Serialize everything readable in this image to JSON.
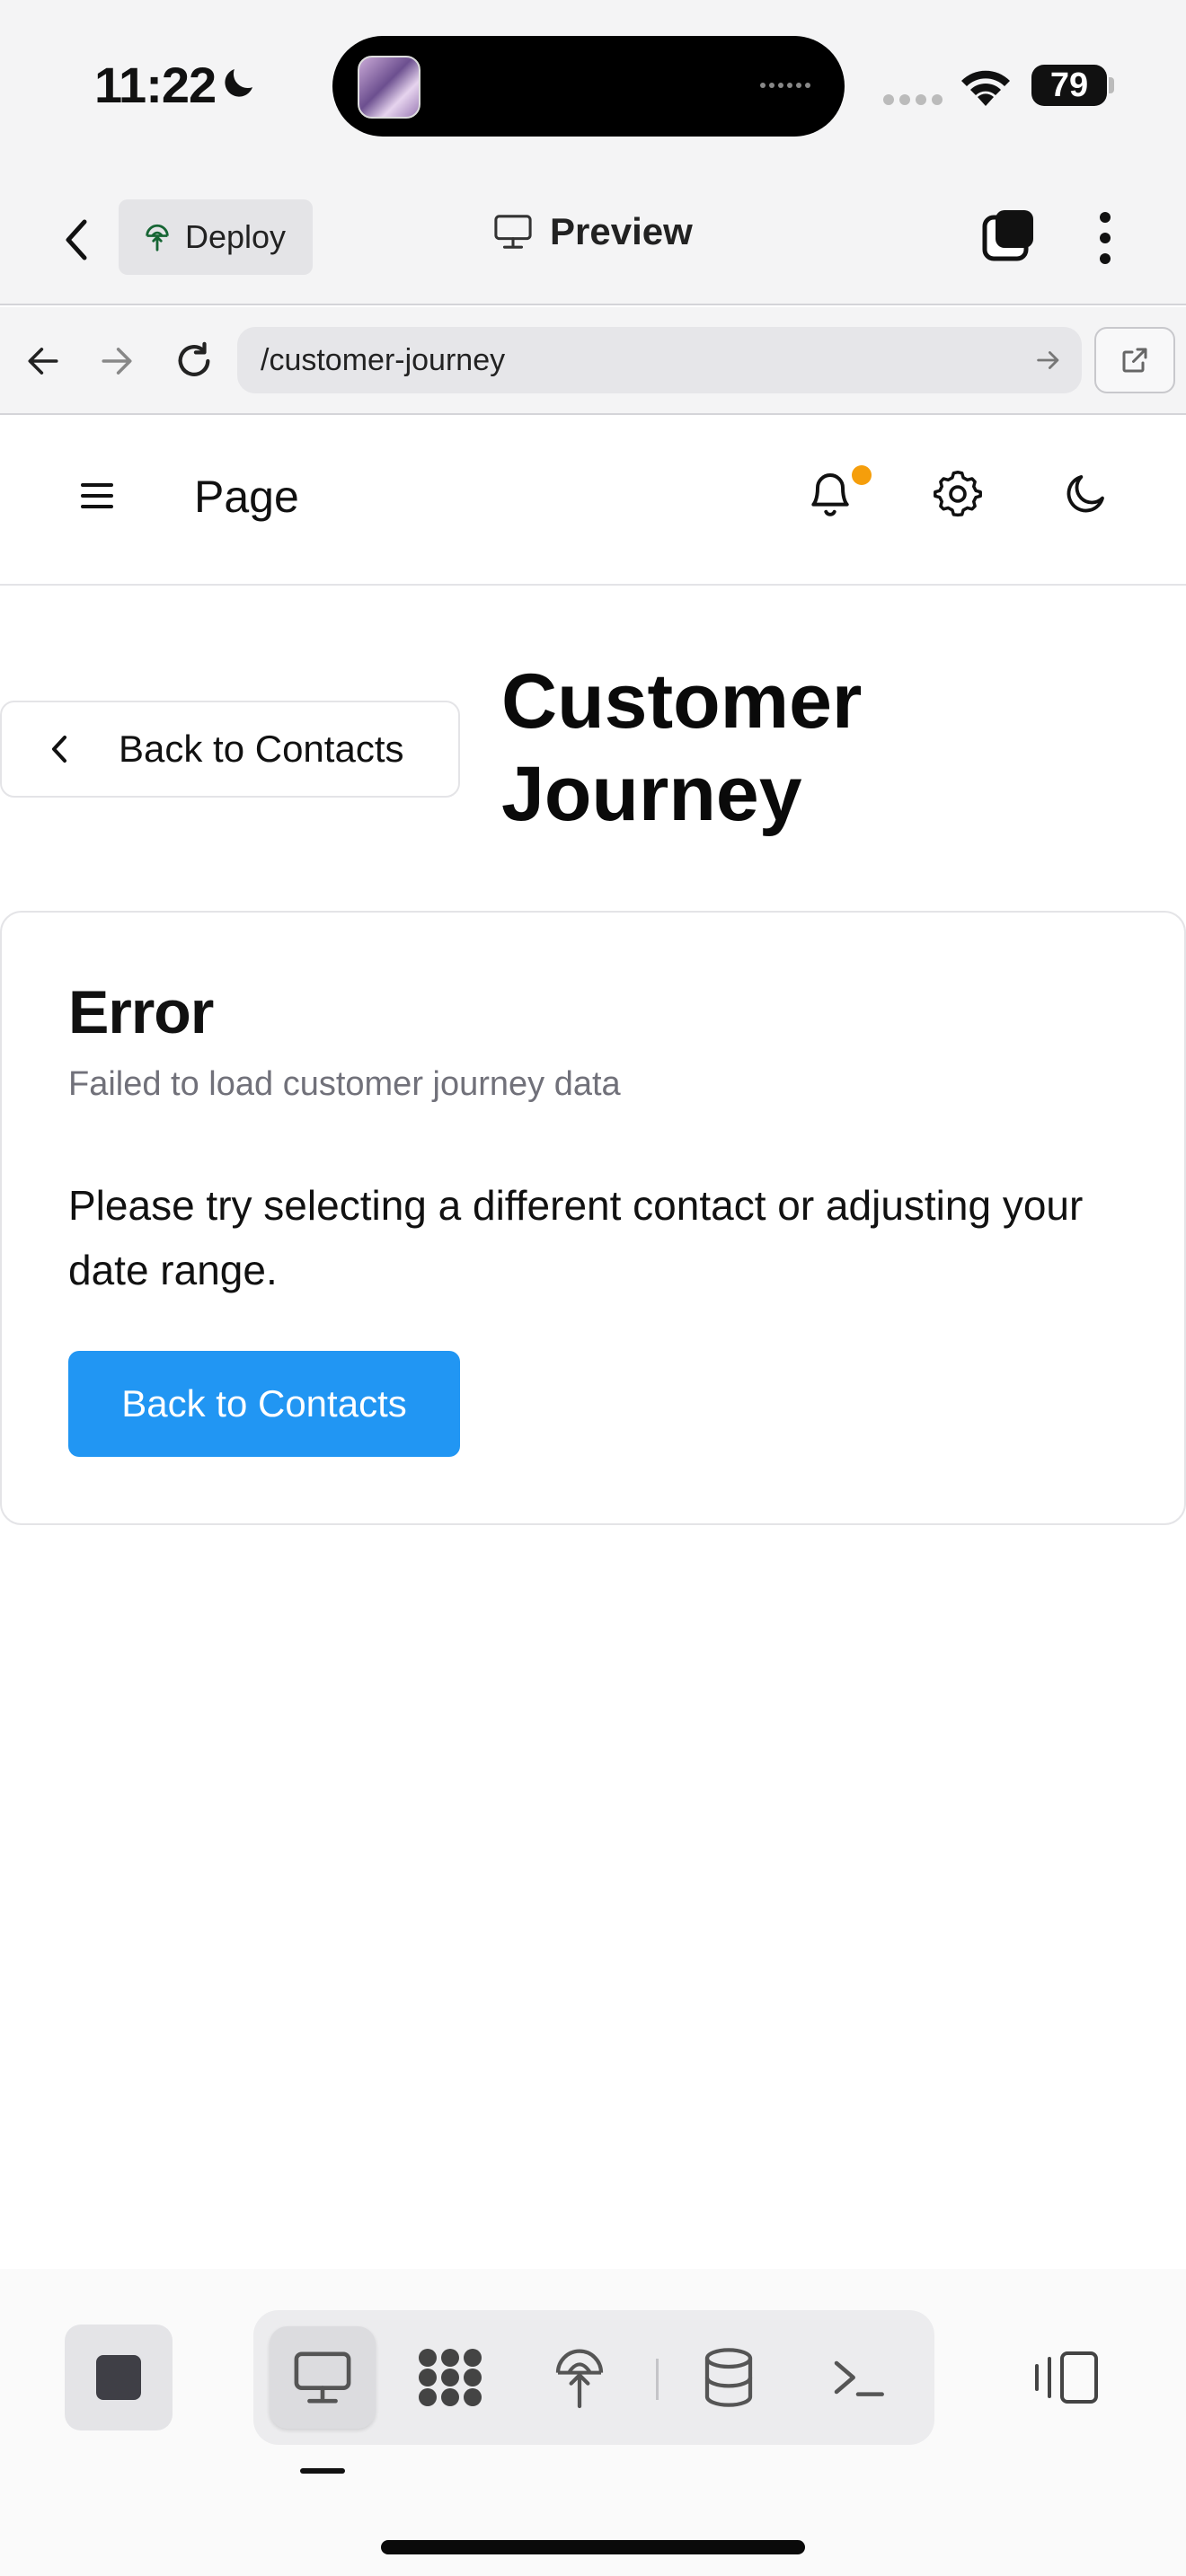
{
  "status_bar": {
    "time": "11:22",
    "battery": "79"
  },
  "app_header": {
    "deploy_label": "Deploy",
    "preview_label": "Preview"
  },
  "browser": {
    "url": "/customer-journey"
  },
  "page_nav": {
    "title": "Page",
    "notification_dot_color": "#f59e0b"
  },
  "header": {
    "back_label": "Back to Contacts",
    "title": "Customer Journey"
  },
  "error_card": {
    "title": "Error",
    "description": "Failed to load customer journey data",
    "message": "Please try selecting a different contact or adjusting your date range.",
    "button_label": "Back to Contacts",
    "button_color": "#2196f3"
  },
  "toolbar": {
    "active_tool": "preview",
    "tools": [
      "preview-icon",
      "apps-grid-icon",
      "deploy-icon",
      "database-icon",
      "terminal-icon"
    ]
  }
}
